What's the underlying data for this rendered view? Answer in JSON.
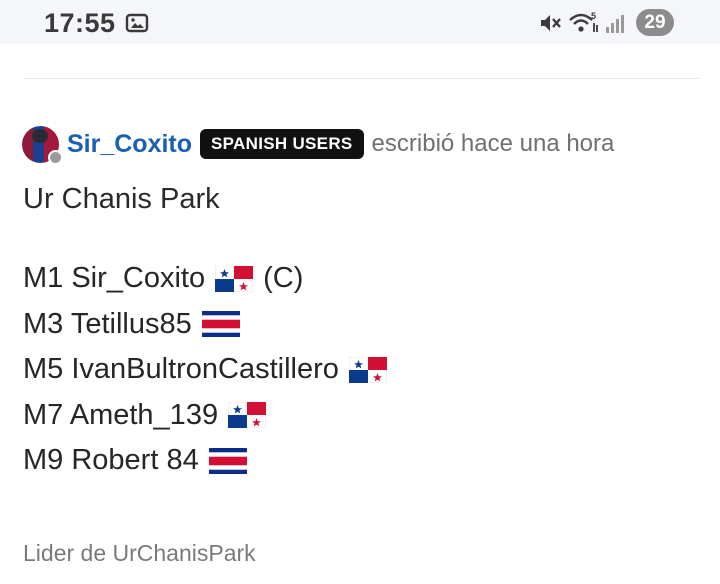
{
  "status_bar": {
    "time": "17:55",
    "battery": "29",
    "icons": [
      "gallery-icon",
      "mute-icon",
      "wifi-icon",
      "signal-icon"
    ]
  },
  "post": {
    "username": "Sir_Coxito",
    "badge": "SPANISH USERS",
    "meta": "escribió hace una hora",
    "title": "Ur Chanis Park",
    "lines": [
      {
        "text": "M1 Sir_Coxito",
        "flag": "panama",
        "suffix": "(C)"
      },
      {
        "text": "M3 Tetillus85",
        "flag": "costa-rica",
        "suffix": ""
      },
      {
        "text": "M5 IvanBultronCastillero",
        "flag": "panama",
        "suffix": ""
      },
      {
        "text": "M7 Ameth_139",
        "flag": "panama",
        "suffix": ""
      },
      {
        "text": "M9 Robert 84",
        "flag": "costa-rica",
        "suffix": ""
      }
    ],
    "footer": "Lider de UrChanisPark"
  }
}
